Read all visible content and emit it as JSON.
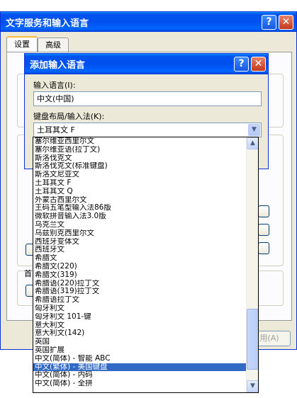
{
  "outer": {
    "title": "文字服务和输入语言",
    "help": "?",
    "close": "✕",
    "tabs": [
      {
        "label": "设置"
      },
      {
        "label": "高级"
      }
    ],
    "frag_first": "首",
    "frag_apply": "用(A)"
  },
  "dialog": {
    "title": "添加输入语言",
    "help": "?",
    "close": "✕",
    "input_lang_label": "输入语言(I):",
    "input_lang_value": "中文(中国)",
    "keyboard_label": "键盘布局/输入法(K):",
    "keyboard_value": "土耳其文 F"
  },
  "dropdown": {
    "items": [
      "塞尔维亚西里尔文",
      "塞尔维亚语(拉丁文)",
      "斯洛伐克文",
      "斯洛伐克文(标准键盘)",
      "斯洛文尼亚文",
      "土耳其文 F",
      "土耳其文 Q",
      "外蒙古西里尔文",
      "王码五笔型输入法86版",
      "微软拼音输入法3.0版",
      "乌克兰文",
      "乌兹别克西里尔文",
      "西班牙变体文",
      "西班牙文",
      "希腊文",
      "希腊文(220)",
      "希腊文(319)",
      "希腊语(220)拉丁文",
      "希腊语(319)拉丁文",
      "希腊语拉丁文",
      "匈牙利文",
      "匈牙利文 101-键",
      "意大利文",
      "意大利文(142)",
      "英国",
      "英国扩展",
      "中文(简体) - 智能 ABC",
      "中文(繁体) - 美国键盘",
      "中文(简体) - 内码",
      "中文(简体) - 全拼"
    ],
    "selected_index": 27,
    "arrow_up": "▲",
    "arrow_down": "▼"
  }
}
